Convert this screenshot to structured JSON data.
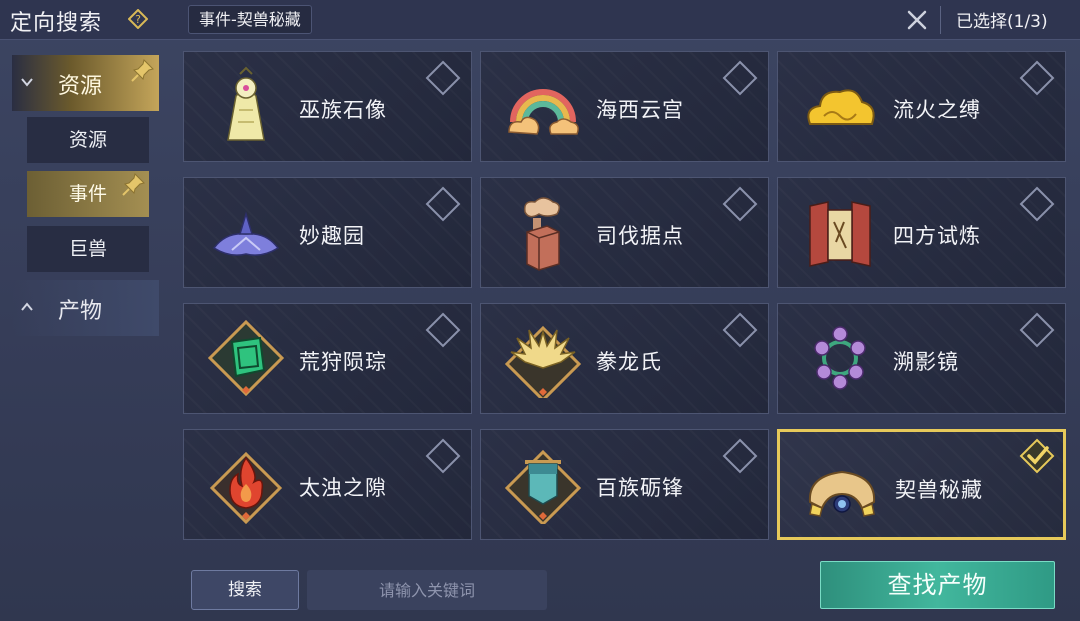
{
  "header": {
    "title": "定向搜索",
    "search_chip": "事件-契兽秘藏",
    "selected_count": "已选择(1/3)"
  },
  "sidebar": {
    "categories": [
      {
        "label": "资源",
        "expanded": true,
        "pinned": true
      },
      {
        "label": "产物",
        "expanded": false,
        "pinned": false
      }
    ],
    "sub_items": [
      {
        "label": "资源",
        "active": false
      },
      {
        "label": "事件",
        "active": true,
        "pinned": true
      },
      {
        "label": "巨兽",
        "active": false
      }
    ]
  },
  "grid": {
    "items": [
      {
        "name": "巫族石像",
        "icon": "shaman-statue-icon",
        "selected": false
      },
      {
        "name": "海西云宫",
        "icon": "rainbow-cloud-icon",
        "selected": false
      },
      {
        "name": "流火之缚",
        "icon": "golden-cloud-icon",
        "selected": false
      },
      {
        "name": "妙趣园",
        "icon": "purple-flower-icon",
        "selected": false
      },
      {
        "name": "司伐据点",
        "icon": "smoking-box-icon",
        "selected": false
      },
      {
        "name": "四方试炼",
        "icon": "trial-banner-icon",
        "selected": false
      },
      {
        "name": "荒狩陨琮",
        "icon": "green-jade-emblem-icon",
        "selected": false
      },
      {
        "name": "豢龙氏",
        "icon": "golden-dragon-emblem-icon",
        "selected": false
      },
      {
        "name": "溯影镜",
        "icon": "lilac-mirror-icon",
        "selected": false
      },
      {
        "name": "太浊之隙",
        "icon": "fire-emblem-icon",
        "selected": false
      },
      {
        "name": "百族砺锋",
        "icon": "banner-emblem-icon",
        "selected": false
      },
      {
        "name": "契兽秘藏",
        "icon": "beast-treasure-icon",
        "selected": true
      }
    ]
  },
  "footer": {
    "search_button": "搜索",
    "keyword_placeholder": "请输入关键词",
    "find_button": "查找产物"
  },
  "colors": {
    "selected_border": "#e6c95a",
    "find_button": "#42b79d",
    "active_tab": "#a48f52"
  }
}
